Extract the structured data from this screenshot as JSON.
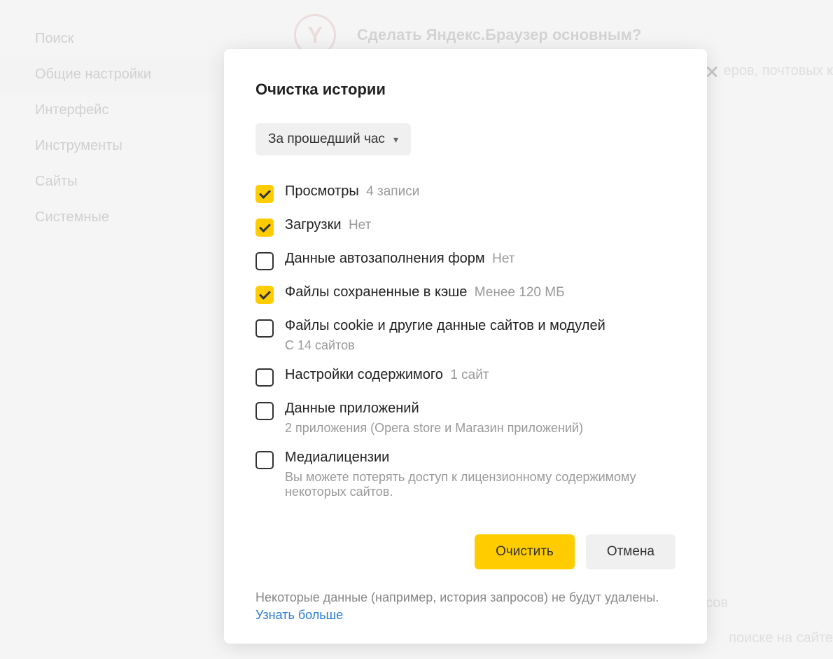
{
  "sidebar": {
    "items": [
      {
        "label": "Поиск"
      },
      {
        "label": "Общие настройки"
      },
      {
        "label": "Интерфейс"
      },
      {
        "label": "Инструменты"
      },
      {
        "label": "Сайты"
      },
      {
        "label": "Системные"
      }
    ]
  },
  "background": {
    "logo_letter": "Y",
    "header_title": "Сделать Яндекс.Браузер основным?",
    "text_right": "еров, почтовых к",
    "text_b1": "сов",
    "text_b2": "поиске на сайте"
  },
  "dialog": {
    "title": "Очистка истории",
    "time_label": "За прошедший час",
    "options": [
      {
        "label": "Просмотры",
        "hint": "4 записи",
        "checked": true
      },
      {
        "label": "Загрузки",
        "hint": "Нет",
        "checked": true
      },
      {
        "label": "Данные автозаполнения форм",
        "hint": "Нет",
        "checked": false
      },
      {
        "label": "Файлы сохраненные в кэше",
        "hint": "Менее 120 МБ",
        "checked": true
      },
      {
        "label": "Файлы cookie и другие данные сайтов и модулей",
        "sub": "С 14 сайтов",
        "checked": false
      },
      {
        "label": "Настройки содержимого",
        "hint": "1 сайт",
        "checked": false
      },
      {
        "label": "Данные приложений",
        "sub": "2 приложения (Opera store и Магазин приложений)",
        "checked": false
      },
      {
        "label": "Медиалицензии",
        "sub": "Вы можете потерять доступ к лицензионному содержимому некоторых сайтов.",
        "checked": false
      }
    ],
    "clear_button": "Очистить",
    "cancel_button": "Отмена",
    "footer_text": "Некоторые данные (например, история запросов) не будут удалены.",
    "footer_link": "Узнать больше"
  }
}
